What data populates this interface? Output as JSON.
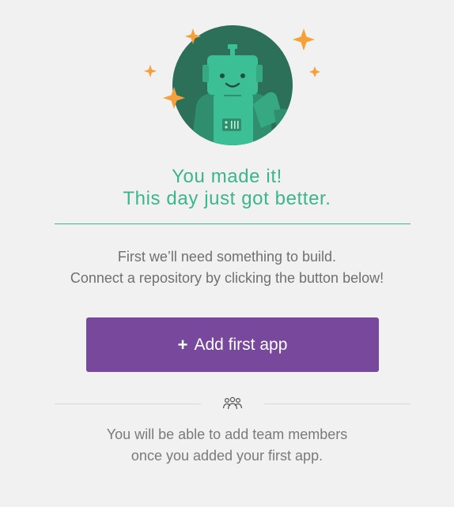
{
  "hero": {
    "icon": "robot-mascot-icon",
    "accent_colors": {
      "circle_dark": "#2a6a55",
      "robot_green": "#3cbf95",
      "sparkle_orange": "#f5a03a"
    }
  },
  "headline": {
    "line1": "You made it!",
    "line2": "This day just got better."
  },
  "intro": {
    "line1": "First we’ll need something to build.",
    "line2": "Connect a repository by clicking the button below!"
  },
  "add_app_button": {
    "plus": "+",
    "label": "Add first app",
    "color": "#77489b"
  },
  "team_section": {
    "icon": "team-icon",
    "line1": "You will be able to add team members",
    "line2": "once you added your first app."
  }
}
